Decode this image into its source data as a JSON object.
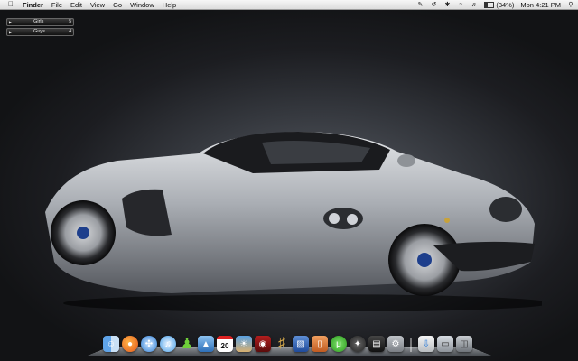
{
  "menubar": {
    "app_name": "Finder",
    "items": [
      "File",
      "Edit",
      "View",
      "Go",
      "Window",
      "Help"
    ],
    "battery": "(34%)",
    "clock": "Mon 4:21 PM"
  },
  "widget": {
    "rows": [
      {
        "label": "Girls",
        "count": "5"
      },
      {
        "label": "Guys",
        "count": "4"
      }
    ]
  },
  "dock": {
    "icons": [
      "finder-icon",
      "firefox-icon",
      "safari-icon",
      "itunes-icon",
      "ichat-icon",
      "preview-icon",
      "ical-icon",
      "iphoto-icon",
      "photo-booth-icon",
      "garageband-icon",
      "keynote-icon",
      "presentation-icon",
      "utorrent-icon",
      "compass-icon",
      "dashboard-icon",
      "system-preferences-icon",
      "downloads-stack-icon",
      "monitor-icon",
      "trash-icon"
    ],
    "ical_day": "20"
  },
  "colors": {
    "menubar_bg": "#e6e6e6",
    "wallpaper_dark": "#1c1d21",
    "car_silver": "#b8bbc0"
  }
}
